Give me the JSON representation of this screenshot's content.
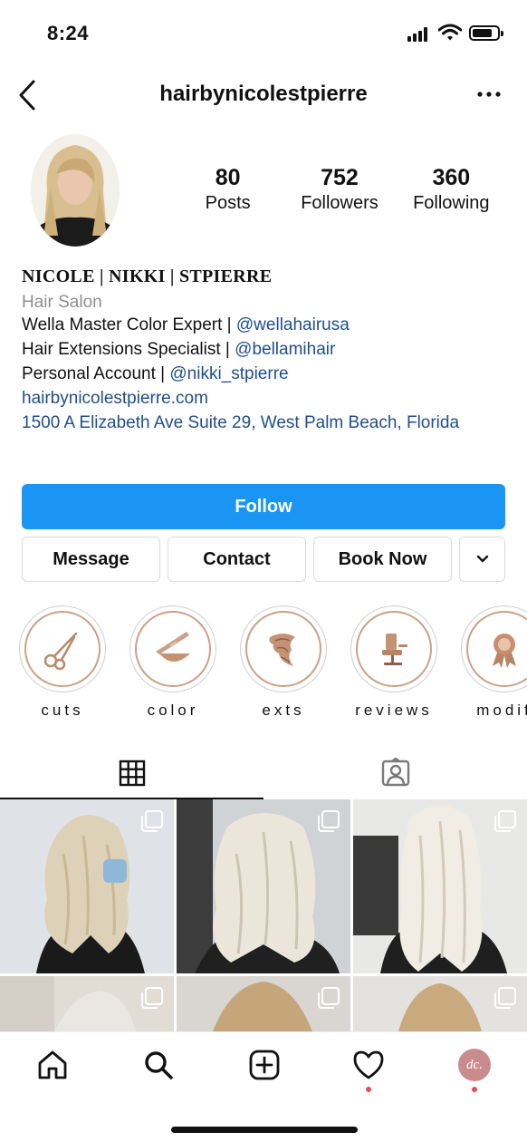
{
  "status_bar": {
    "time": "8:24"
  },
  "nav": {
    "username": "hairbynicolestpierre"
  },
  "profile": {
    "stats": [
      {
        "value": "80",
        "label": "Posts"
      },
      {
        "value": "752",
        "label": "Followers"
      },
      {
        "value": "360",
        "label": "Following"
      }
    ],
    "display_name": "NICOLE | NIKKI | STPIERRE",
    "category": "Hair Salon",
    "bio": [
      {
        "text": "Wella Master Color Expert | ",
        "mention": "@wellahairusa"
      },
      {
        "text": "Hair Extensions Specialist | ",
        "mention": "@bellamihair"
      },
      {
        "text": "Personal Account | ",
        "mention": "@nikki_stpierre"
      }
    ],
    "website": "hairbynicolestpierre.com",
    "address": "1500 A Elizabeth Ave Suite 29, West Palm Beach, Florida"
  },
  "actions": {
    "follow": "Follow",
    "message": "Message",
    "contact": "Contact",
    "book_now": "Book Now"
  },
  "highlights": [
    {
      "label": "cuts",
      "icon": "scissors-icon"
    },
    {
      "label": "color",
      "icon": "color-bowl-icon"
    },
    {
      "label": "exts",
      "icon": "hair-extensions-icon"
    },
    {
      "label": "reviews",
      "icon": "salon-chair-icon"
    },
    {
      "label": "modif",
      "icon": "award-ribbon-icon"
    }
  ],
  "tabs": [
    {
      "name": "posts-grid",
      "icon": "grid-icon",
      "active": true
    },
    {
      "name": "tagged",
      "icon": "tagged-person-icon",
      "active": false
    }
  ],
  "bottom_nav": [
    {
      "name": "home",
      "icon": "home-icon"
    },
    {
      "name": "search",
      "icon": "search-icon"
    },
    {
      "name": "new-post",
      "icon": "add-post-icon"
    },
    {
      "name": "activity",
      "icon": "heart-icon",
      "badge": true
    },
    {
      "name": "profile",
      "icon": "profile-avatar",
      "avatar_text": "dc.",
      "badge": true
    }
  ],
  "colors": {
    "follow_button": "#1a95f3",
    "link": "#1f4e8c",
    "highlight_ring": "#caa187",
    "notification_dot": "#ed4956"
  }
}
